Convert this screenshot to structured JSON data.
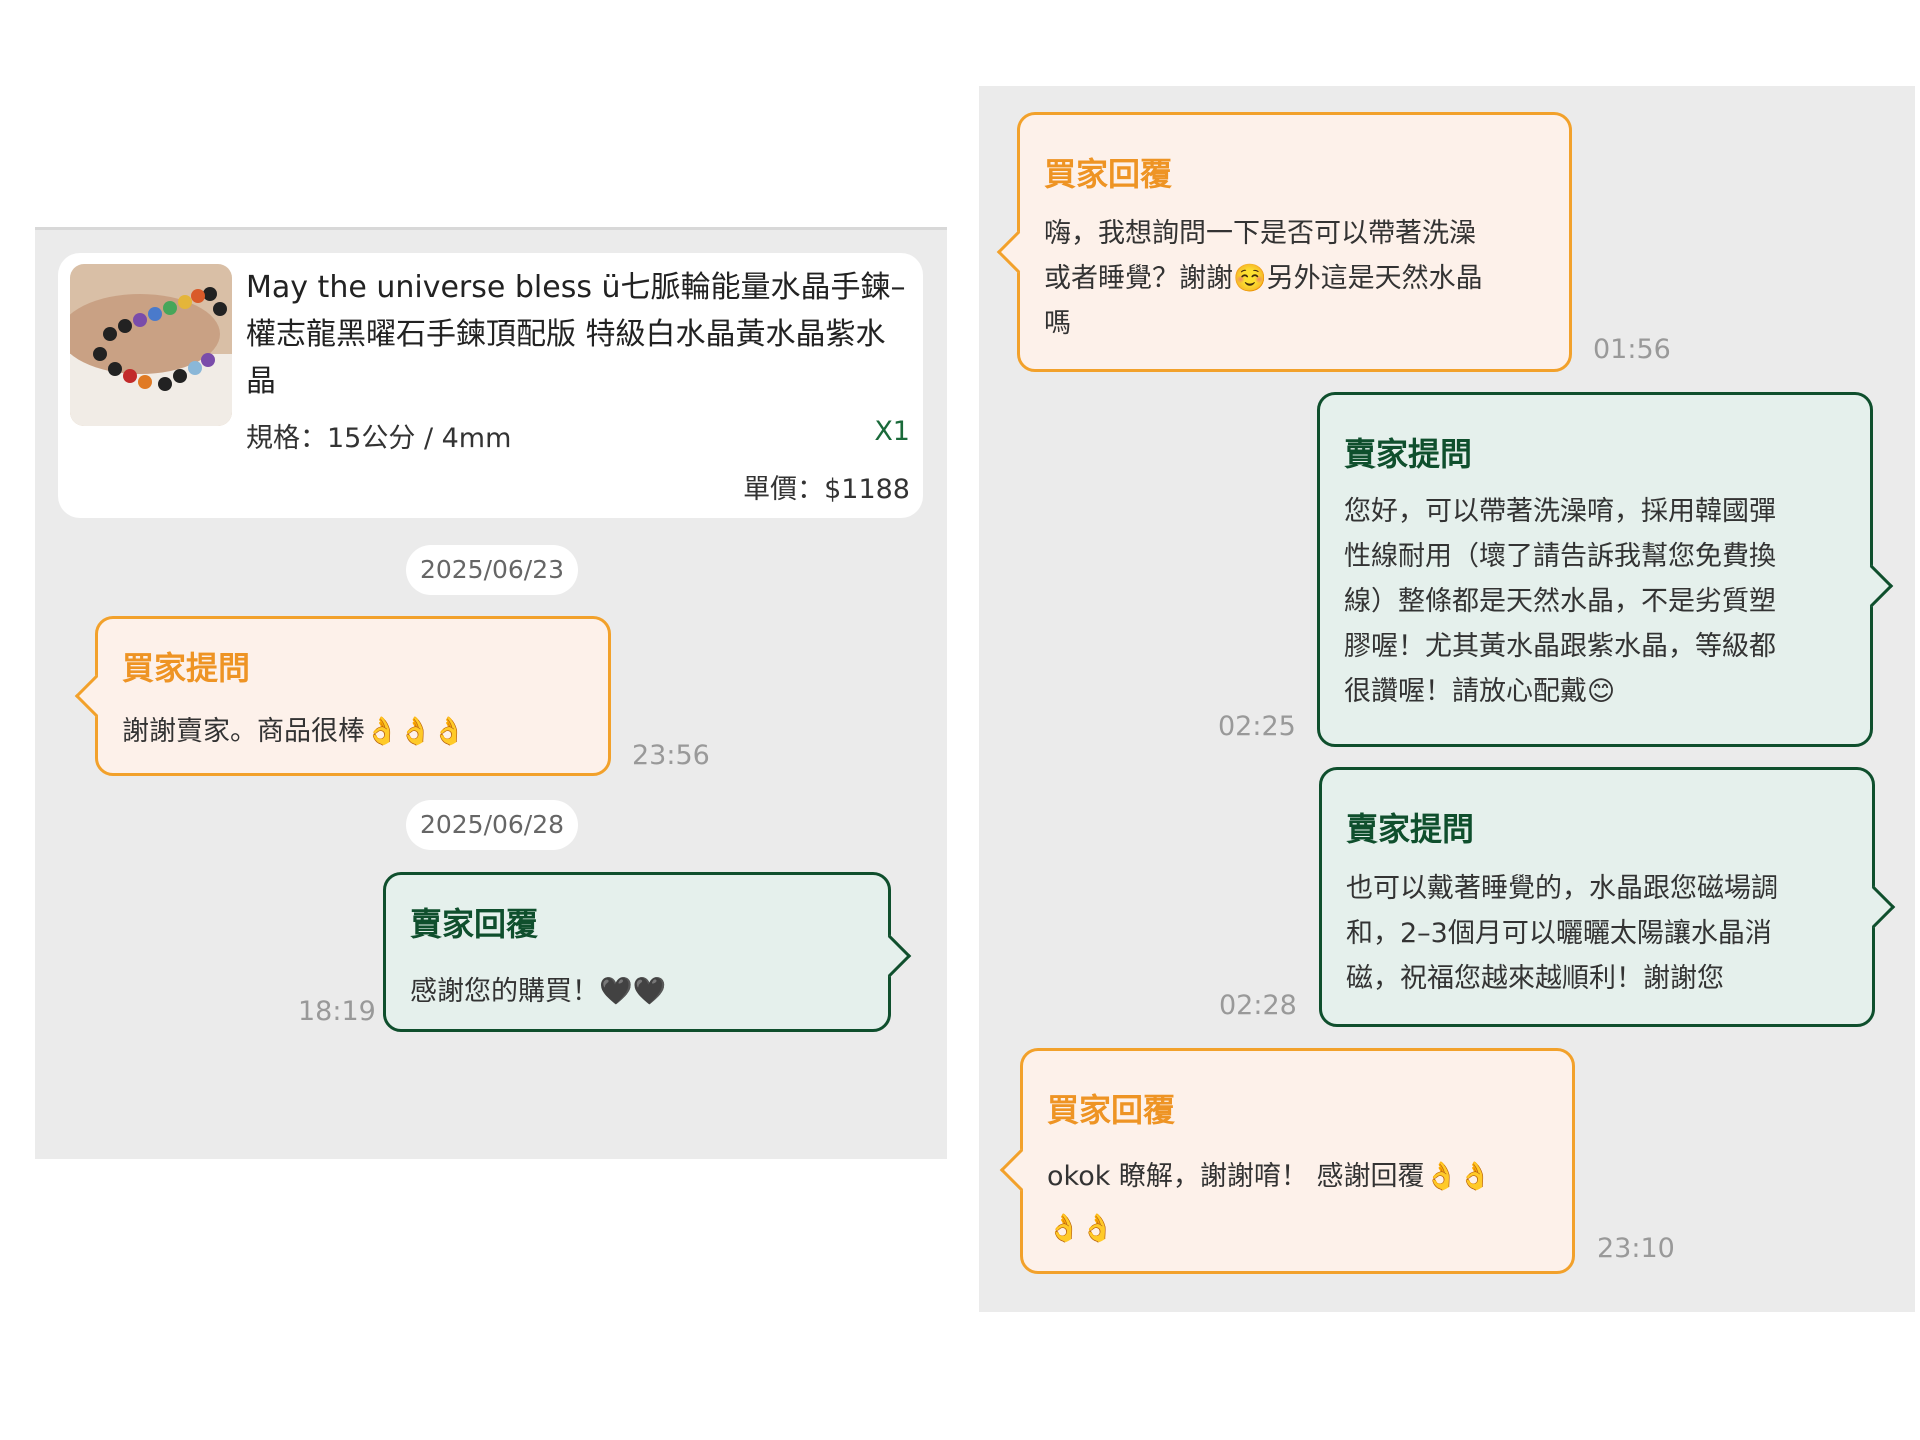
{
  "product": {
    "title": "May the universe bless ü七脈輪能量水晶手鍊–權志龍黑曜石手鍊頂配版 特級白水晶黃水晶紫水晶",
    "spec": "規格：15公分 / 4mm",
    "qty": "X1",
    "price": "單價：$1188"
  },
  "left": {
    "date1": "2025/06/23",
    "msg1": {
      "title": "買家提問",
      "text": "謝謝賣家。商品很棒👌👌👌",
      "time": "23:56"
    },
    "date2": "2025/06/28",
    "msg2": {
      "title": "賣家回覆",
      "text": "感謝您的購買！🖤🖤",
      "time": "18:19"
    }
  },
  "right": {
    "msg1": {
      "title": "買家回覆",
      "text": "嗨，我想詢問一下是否可以帶著洗澡\n或者睡覺？謝謝☺️另外這是天然水晶\n嗎",
      "time": "01:56"
    },
    "msg2": {
      "title": "賣家提問",
      "text": "您好，可以帶著洗澡唷，採用韓國彈\n性線耐用（壞了請告訴我幫您免費換\n線）整條都是天然水晶，不是劣質塑\n膠喔！尤其黃水晶跟紫水晶，等級都\n很讚喔！請放心配戴😊",
      "time": "02:25"
    },
    "msg3": {
      "title": "賣家提問",
      "text": "也可以戴著睡覺的，水晶跟您磁場調\n和，2–3個月可以曬曬太陽讓水晶消\n磁，祝福您越來越順利！謝謝您",
      "time": "02:28"
    },
    "msg4": {
      "title": "買家回覆",
      "text": "okok 瞭解，謝謝唷！ 感謝回覆👌👌\n👌👌",
      "time": "23:10"
    }
  }
}
